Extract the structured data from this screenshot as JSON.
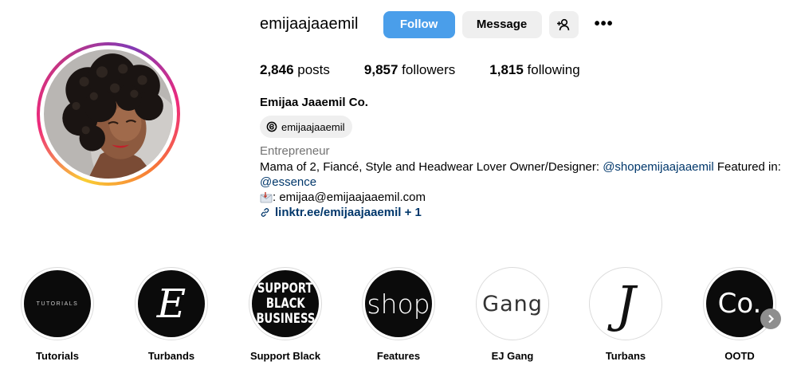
{
  "profile": {
    "username": "emijaajaaemil",
    "follow_label": "Follow",
    "message_label": "Message",
    "more_label": "•••",
    "full_name": "Emijaa Jaaemil Co.",
    "threads_handle": "emijaajaaemil",
    "category": "Entrepreneur",
    "bio_text_1": "Mama of 2, Fiancé, Style and Headwear Lover Owner/Designer: ",
    "bio_mention_1": "@shopemijaajaaemil",
    "bio_text_2": " Featured in: ",
    "bio_mention_2": "@essence",
    "email_prefix": ": ",
    "email": "emijaa@emijaajaaemil.com",
    "link": "linktr.ee/emijaajaaemil + 1"
  },
  "stats": {
    "posts_count": "2,846",
    "posts_label": " posts",
    "followers_count": "9,857",
    "followers_label": " followers",
    "following_count": "1,815",
    "following_label": " following"
  },
  "highlights": [
    {
      "label": "Tutorials",
      "cover_text": "TUTORIALS"
    },
    {
      "label": "Turbands",
      "cover_text": "E"
    },
    {
      "label": "Support Black",
      "cover_text_lines": [
        "SUPPORT",
        "BLACK",
        "BUSINESS"
      ]
    },
    {
      "label": "Features",
      "cover_text": "shop"
    },
    {
      "label": "EJ Gang",
      "cover_text": "Gang"
    },
    {
      "label": "Turbans",
      "cover_text": "J"
    },
    {
      "label": "OOTD",
      "cover_text": "Co."
    }
  ],
  "icons": {
    "add_user": "add-person-icon",
    "more": "more-options-icon",
    "threads": "threads-icon",
    "email": "envelope-icon",
    "link": "link-icon",
    "next": "chevron-right-icon"
  },
  "colors": {
    "follow_button": "#4a9eea",
    "secondary_button": "#efefef",
    "link": "#00376b",
    "muted_text": "#737373"
  }
}
